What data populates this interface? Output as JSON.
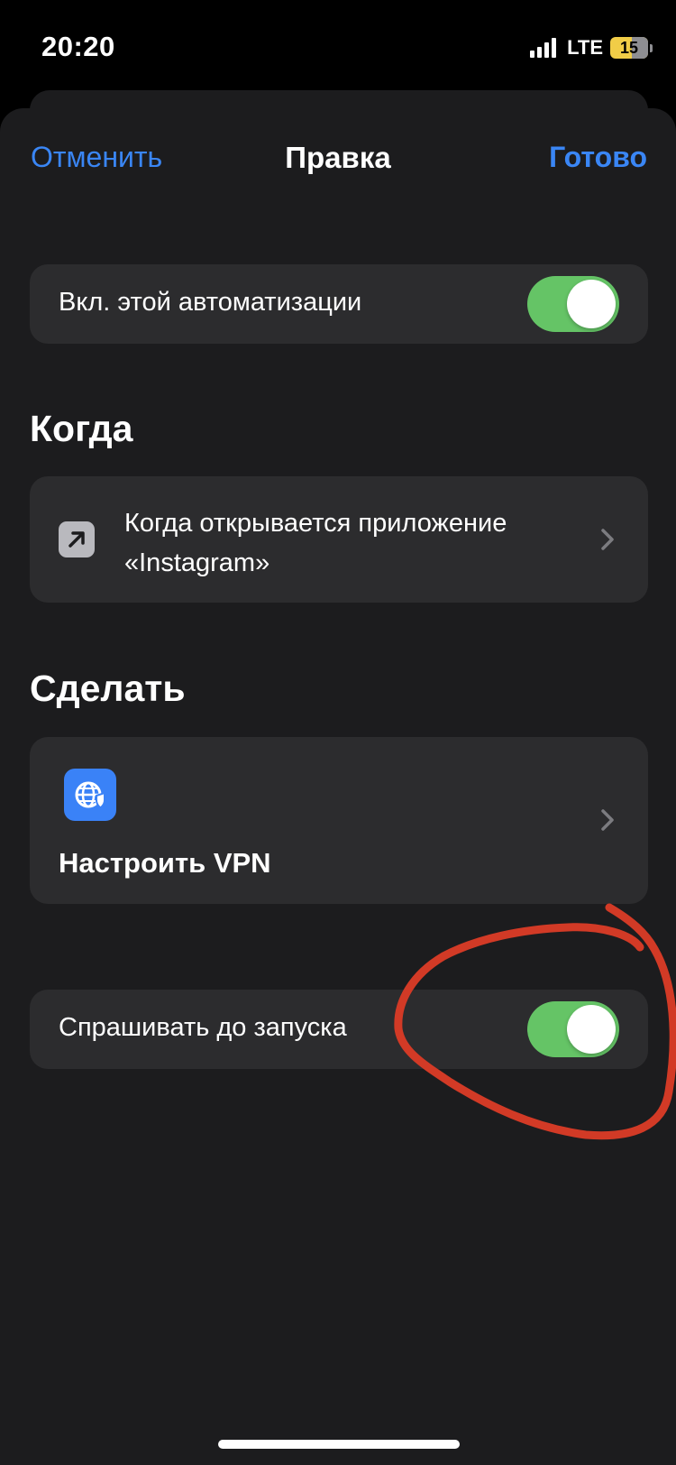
{
  "status_bar": {
    "time": "20:20",
    "network": "LTE",
    "battery_level": "15"
  },
  "nav": {
    "cancel_label": "Отменить",
    "title": "Правка",
    "done_label": "Готово"
  },
  "enable_row": {
    "label": "Вкл. этой автоматизации",
    "enabled": true
  },
  "when_section": {
    "title": "Когда",
    "trigger_text": "Когда открывается приложение «Instagram»",
    "icon": "arrow-up-right-icon"
  },
  "do_section": {
    "title": "Сделать",
    "action_label": "Настроить VPN",
    "icon": "globe-shield-icon"
  },
  "ask_row": {
    "label": "Спрашивать до запуска",
    "enabled": true
  },
  "colors": {
    "accent": "#3a86f5",
    "toggle_on": "#65c466",
    "sheet_bg": "#1c1c1e",
    "card_bg": "#2c2c2e",
    "annotation": "#d23a26"
  }
}
